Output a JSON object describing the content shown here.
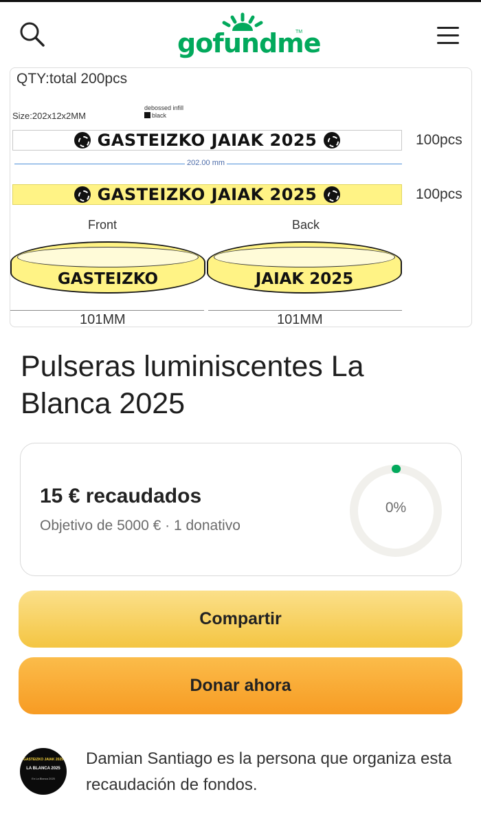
{
  "header": {
    "logo_text": "gofundme",
    "logo_tm": "TM",
    "brand_color": "#02a95c",
    "icons": [
      "search-icon",
      "hamburger-menu-icon"
    ]
  },
  "product_image": {
    "qty": "QTY:total 200pcs",
    "size": "Size:202x12x2MM",
    "infill_line1": "debossed infill",
    "infill_line2": "black",
    "strap_text": "GASTEIZKO JAIAK 2025",
    "pcs_1": "100pcs",
    "pcs_2": "100pcs",
    "dimension": "202.00 mm",
    "front_label": "Front",
    "back_label": "Back",
    "front_text": "GASTEIZKO",
    "back_text": "JAIAK 2025",
    "mm_front": "101MM",
    "mm_back": "101MM",
    "strap_color": "#fff385"
  },
  "campaign": {
    "title": "Pulseras luminiscentes La Blanca 2025"
  },
  "stats": {
    "raised": "15 € recaudados",
    "goal": "Objetivo de 5000 €  ·  1 donativo",
    "progress_label": "0%",
    "progress_fraction": 0.003,
    "progress_color": "#02a95c"
  },
  "buttons": {
    "share": "Compartir",
    "donate": "Donar ahora"
  },
  "organizer": {
    "text": "Damian Santiago es la persona que organiza esta recaudación de fondos.",
    "avatar_line1": "GASTEIZKO JAIAK 2025",
    "avatar_line2": "LA BLANCA 2025",
    "avatar_line3": "En La Blanca 2025"
  }
}
